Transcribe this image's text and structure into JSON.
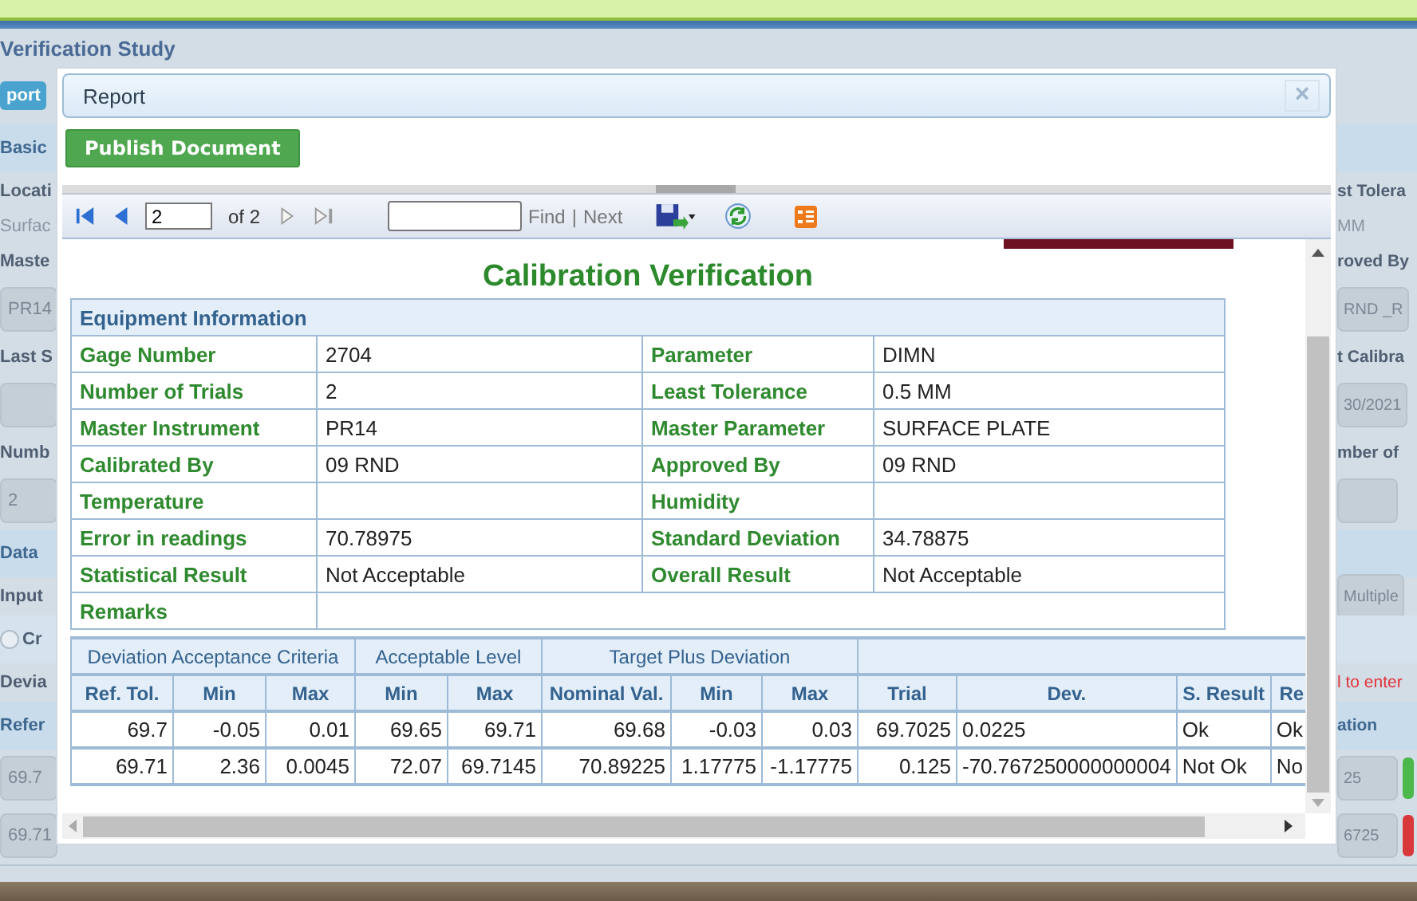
{
  "page": {
    "title": "Verification Study",
    "rows": [
      {
        "left": {
          "kind": "button",
          "text": "port"
        },
        "right": {
          "kind": "blank"
        }
      },
      {
        "left": {
          "kind": "section",
          "text": "Basic"
        },
        "right": {
          "kind": "section"
        }
      },
      {
        "left": {
          "kind": "label",
          "text": "Locati"
        },
        "right": {
          "kind": "label",
          "text": "st Tolera"
        }
      },
      {
        "left": {
          "kind": "value",
          "text": "Surfac"
        },
        "right": {
          "kind": "value",
          "text": "MM"
        }
      },
      {
        "left": {
          "kind": "label",
          "text": "Maste"
        },
        "right": {
          "kind": "label",
          "text": "roved By"
        }
      },
      {
        "left": {
          "kind": "field",
          "text": "PR14"
        },
        "right": {
          "kind": "field",
          "text": "RND _R"
        }
      },
      {
        "left": {
          "kind": "label",
          "text": "Last S"
        },
        "right": {
          "kind": "label",
          "text": "t Calibra"
        }
      },
      {
        "left": {
          "kind": "field"
        },
        "right": {
          "kind": "field",
          "text": "30/2021"
        }
      },
      {
        "left": {
          "kind": "label",
          "text": "Numb"
        },
        "right": {
          "kind": "label",
          "text": "mber of"
        }
      },
      {
        "left": {
          "kind": "field",
          "text": "2"
        },
        "right": {
          "kind": "field"
        }
      },
      {
        "left": {
          "kind": "section",
          "text": "Data"
        },
        "right": {
          "kind": "section"
        }
      },
      {
        "left": {
          "kind": "label",
          "text": "Input"
        },
        "right": {
          "kind": "field",
          "text": "Multiple"
        }
      },
      {
        "left": {
          "kind": "radio",
          "text": "Cr",
          "checked": false
        },
        "right": {
          "kind": "blank"
        }
      },
      {
        "left": {
          "kind": "label",
          "text": "Devia"
        },
        "right": {
          "kind": "note",
          "text": "l to enter"
        }
      },
      {
        "left": {
          "kind": "header",
          "text": "Refer"
        },
        "right": {
          "kind": "header",
          "text": "ation"
        }
      },
      {
        "left": {
          "kind": "field",
          "text": "69.7"
        },
        "right": {
          "kind": "field",
          "text": "25",
          "color": "#4cb84c"
        }
      },
      {
        "left": {
          "kind": "field",
          "text": "69.71"
        },
        "right": {
          "kind": "field",
          "text": "6725",
          "color": "#d9383a"
        }
      }
    ]
  },
  "dialog": {
    "title": "Report",
    "close": "×",
    "publish_button": "Publish Document",
    "toolbar": {
      "nav": [
        {
          "kind": "first",
          "disabled": false
        },
        {
          "kind": "prev",
          "disabled": false
        }
      ],
      "page": "2",
      "of": "of 2",
      "nav_after": [
        {
          "kind": "next",
          "disabled": true
        },
        {
          "kind": "last",
          "disabled": true
        }
      ],
      "find": "Find",
      "separator": "|",
      "next": "Next"
    },
    "report": {
      "title": "Calibration Verification",
      "equipment": {
        "heading": "Equipment Information",
        "rows": [
          [
            {
              "label": "Gage Number",
              "value": "2704"
            },
            {
              "label": "Parameter",
              "value": "DIMN"
            }
          ],
          [
            {
              "label": "Number of Trials",
              "value": "2"
            },
            {
              "label": "Least Tolerance",
              "value": "0.5 MM"
            }
          ],
          [
            {
              "label": "Master Instrument",
              "value": "PR14"
            },
            {
              "label": "Master Parameter",
              "value": "SURFACE PLATE"
            }
          ],
          [
            {
              "label": "Calibrated By",
              "value": "09 RND"
            },
            {
              "label": "Approved By",
              "value": "09 RND"
            }
          ],
          [
            {
              "label": "Temperature"
            },
            {
              "label": "Humidity"
            }
          ],
          [
            {
              "label": "Error in readings",
              "value": "70.78975"
            },
            {
              "label": "Standard Deviation",
              "value": "34.78875"
            }
          ],
          [
            {
              "label": "Statistical Result",
              "value": "Not Acceptable"
            },
            {
              "label": "Overall Result",
              "value": "Not Acceptable"
            }
          ],
          [
            {
              "label": "Remarks"
            }
          ]
        ]
      },
      "deviation": {
        "groups": [
          {
            "label": "Deviation Acceptance Criteria",
            "columns": [
              "Ref. Tol.",
              "Min",
              "Max"
            ]
          },
          {
            "label": "Acceptable Level",
            "columns": [
              "Min",
              "Max"
            ]
          },
          {
            "label": "Target Plus Deviation",
            "columns": [
              "Nominal Val.",
              "Min",
              "Max"
            ]
          },
          {
            "columns": [
              "Trial",
              "Dev.",
              "S. Result",
              "Re"
            ]
          }
        ],
        "rows": [
          [
            "69.7",
            "-0.05",
            "0.01",
            "69.65",
            "69.71",
            "69.68",
            "-0.03",
            "0.03",
            "69.7025",
            "0.0225",
            "Ok",
            "Ok"
          ],
          [
            "69.71",
            "2.36",
            "0.0045",
            "72.07",
            "69.7145",
            "70.89225",
            "1.17775",
            "-1.17775",
            "0.125",
            "-70.767250000000004",
            "Not Ok",
            "No"
          ]
        ]
      }
    }
  }
}
